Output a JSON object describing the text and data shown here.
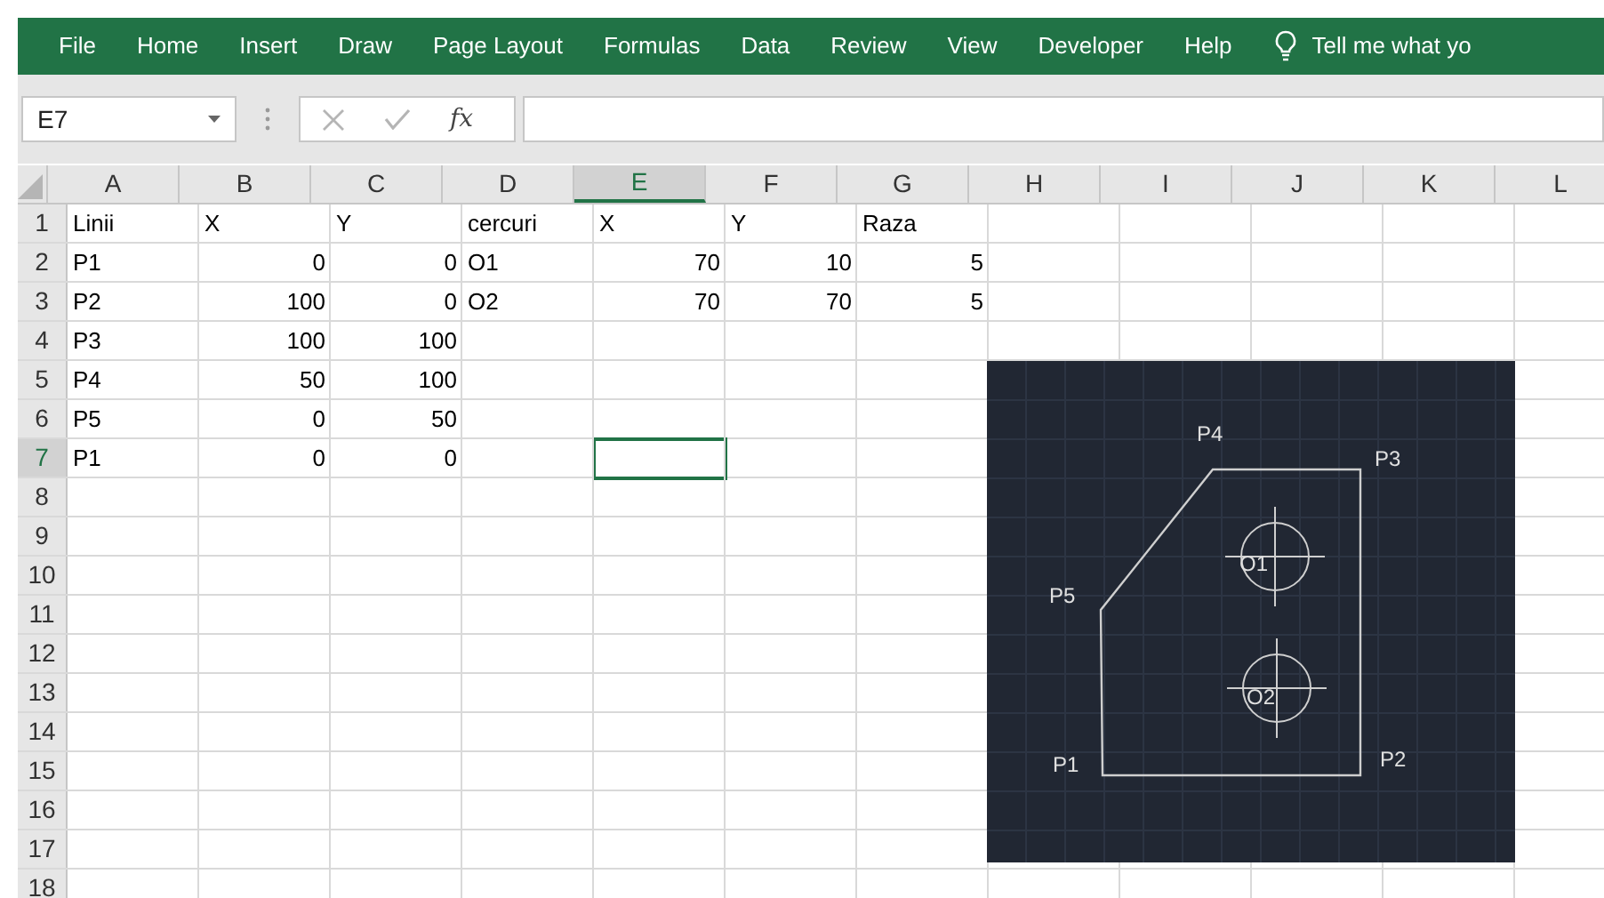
{
  "ribbon_tabs": [
    {
      "label": "File",
      "selected": false
    },
    {
      "label": "Home",
      "selected": false
    },
    {
      "label": "Insert",
      "selected": false
    },
    {
      "label": "Draw",
      "selected": false
    },
    {
      "label": "Page Layout",
      "selected": false
    },
    {
      "label": "Formulas",
      "selected": false
    },
    {
      "label": "Data",
      "selected": false
    },
    {
      "label": "Review",
      "selected": false
    },
    {
      "label": "View",
      "selected": false
    },
    {
      "label": "Developer",
      "selected": false
    },
    {
      "label": "Help",
      "selected": false
    }
  ],
  "tell_me": "Tell me what yo",
  "name_box": "E7",
  "fx_label": "fx",
  "columns": [
    {
      "label": "A",
      "selected": false
    },
    {
      "label": "B",
      "selected": false
    },
    {
      "label": "C",
      "selected": false
    },
    {
      "label": "D",
      "selected": false
    },
    {
      "label": "E",
      "selected": true
    },
    {
      "label": "F",
      "selected": false
    },
    {
      "label": "G",
      "selected": false
    },
    {
      "label": "H",
      "selected": false
    },
    {
      "label": "I",
      "selected": false
    },
    {
      "label": "J",
      "selected": false
    },
    {
      "label": "K",
      "selected": false
    },
    {
      "label": "L",
      "selected": false
    }
  ],
  "rows": [
    {
      "number": "1",
      "selected": false,
      "cells": [
        {
          "text": "Linii",
          "kind": "text"
        },
        {
          "text": "X",
          "kind": "text"
        },
        {
          "text": "Y",
          "kind": "text"
        },
        {
          "text": "cercuri",
          "kind": "text"
        },
        {
          "text": "X",
          "kind": "text"
        },
        {
          "text": "Y",
          "kind": "text"
        },
        {
          "text": "Raza",
          "kind": "text"
        }
      ]
    },
    {
      "number": "2",
      "selected": false,
      "cells": [
        {
          "text": "P1",
          "kind": "text"
        },
        {
          "text": "0",
          "kind": "number"
        },
        {
          "text": "0",
          "kind": "number"
        },
        {
          "text": "O1",
          "kind": "text"
        },
        {
          "text": "70",
          "kind": "number"
        },
        {
          "text": "10",
          "kind": "number"
        },
        {
          "text": "5",
          "kind": "number"
        }
      ]
    },
    {
      "number": "3",
      "selected": false,
      "cells": [
        {
          "text": "P2",
          "kind": "text"
        },
        {
          "text": "100",
          "kind": "number"
        },
        {
          "text": "0",
          "kind": "number"
        },
        {
          "text": "O2",
          "kind": "text"
        },
        {
          "text": "70",
          "kind": "number"
        },
        {
          "text": "70",
          "kind": "number"
        },
        {
          "text": "5",
          "kind": "number"
        }
      ]
    },
    {
      "number": "4",
      "selected": false,
      "cells": [
        {
          "text": "P3",
          "kind": "text"
        },
        {
          "text": "100",
          "kind": "number"
        },
        {
          "text": "100",
          "kind": "number"
        }
      ]
    },
    {
      "number": "5",
      "selected": false,
      "cells": [
        {
          "text": "P4",
          "kind": "text"
        },
        {
          "text": "50",
          "kind": "number"
        },
        {
          "text": "100",
          "kind": "number"
        }
      ]
    },
    {
      "number": "6",
      "selected": false,
      "cells": [
        {
          "text": "P5",
          "kind": "text"
        },
        {
          "text": "0",
          "kind": "number"
        },
        {
          "text": "50",
          "kind": "number"
        }
      ]
    },
    {
      "number": "7",
      "selected": true,
      "cells": [
        {
          "text": "P1",
          "kind": "text"
        },
        {
          "text": "0",
          "kind": "number"
        },
        {
          "text": "0",
          "kind": "number"
        }
      ]
    },
    {
      "number": "8",
      "selected": false
    },
    {
      "number": "9",
      "selected": false
    },
    {
      "number": "10",
      "selected": false
    },
    {
      "number": "11",
      "selected": false
    },
    {
      "number": "12",
      "selected": false
    },
    {
      "number": "13",
      "selected": false
    },
    {
      "number": "14",
      "selected": false
    },
    {
      "number": "15",
      "selected": false
    },
    {
      "number": "16",
      "selected": false
    },
    {
      "number": "17",
      "selected": false
    },
    {
      "number": "18",
      "selected": false
    }
  ],
  "drawing": {
    "labels": [
      {
        "text": "P4"
      },
      {
        "text": "P3"
      },
      {
        "text": "P5"
      },
      {
        "text": "P1"
      },
      {
        "text": "P2"
      },
      {
        "text": "O1"
      },
      {
        "text": "O2"
      }
    ]
  }
}
